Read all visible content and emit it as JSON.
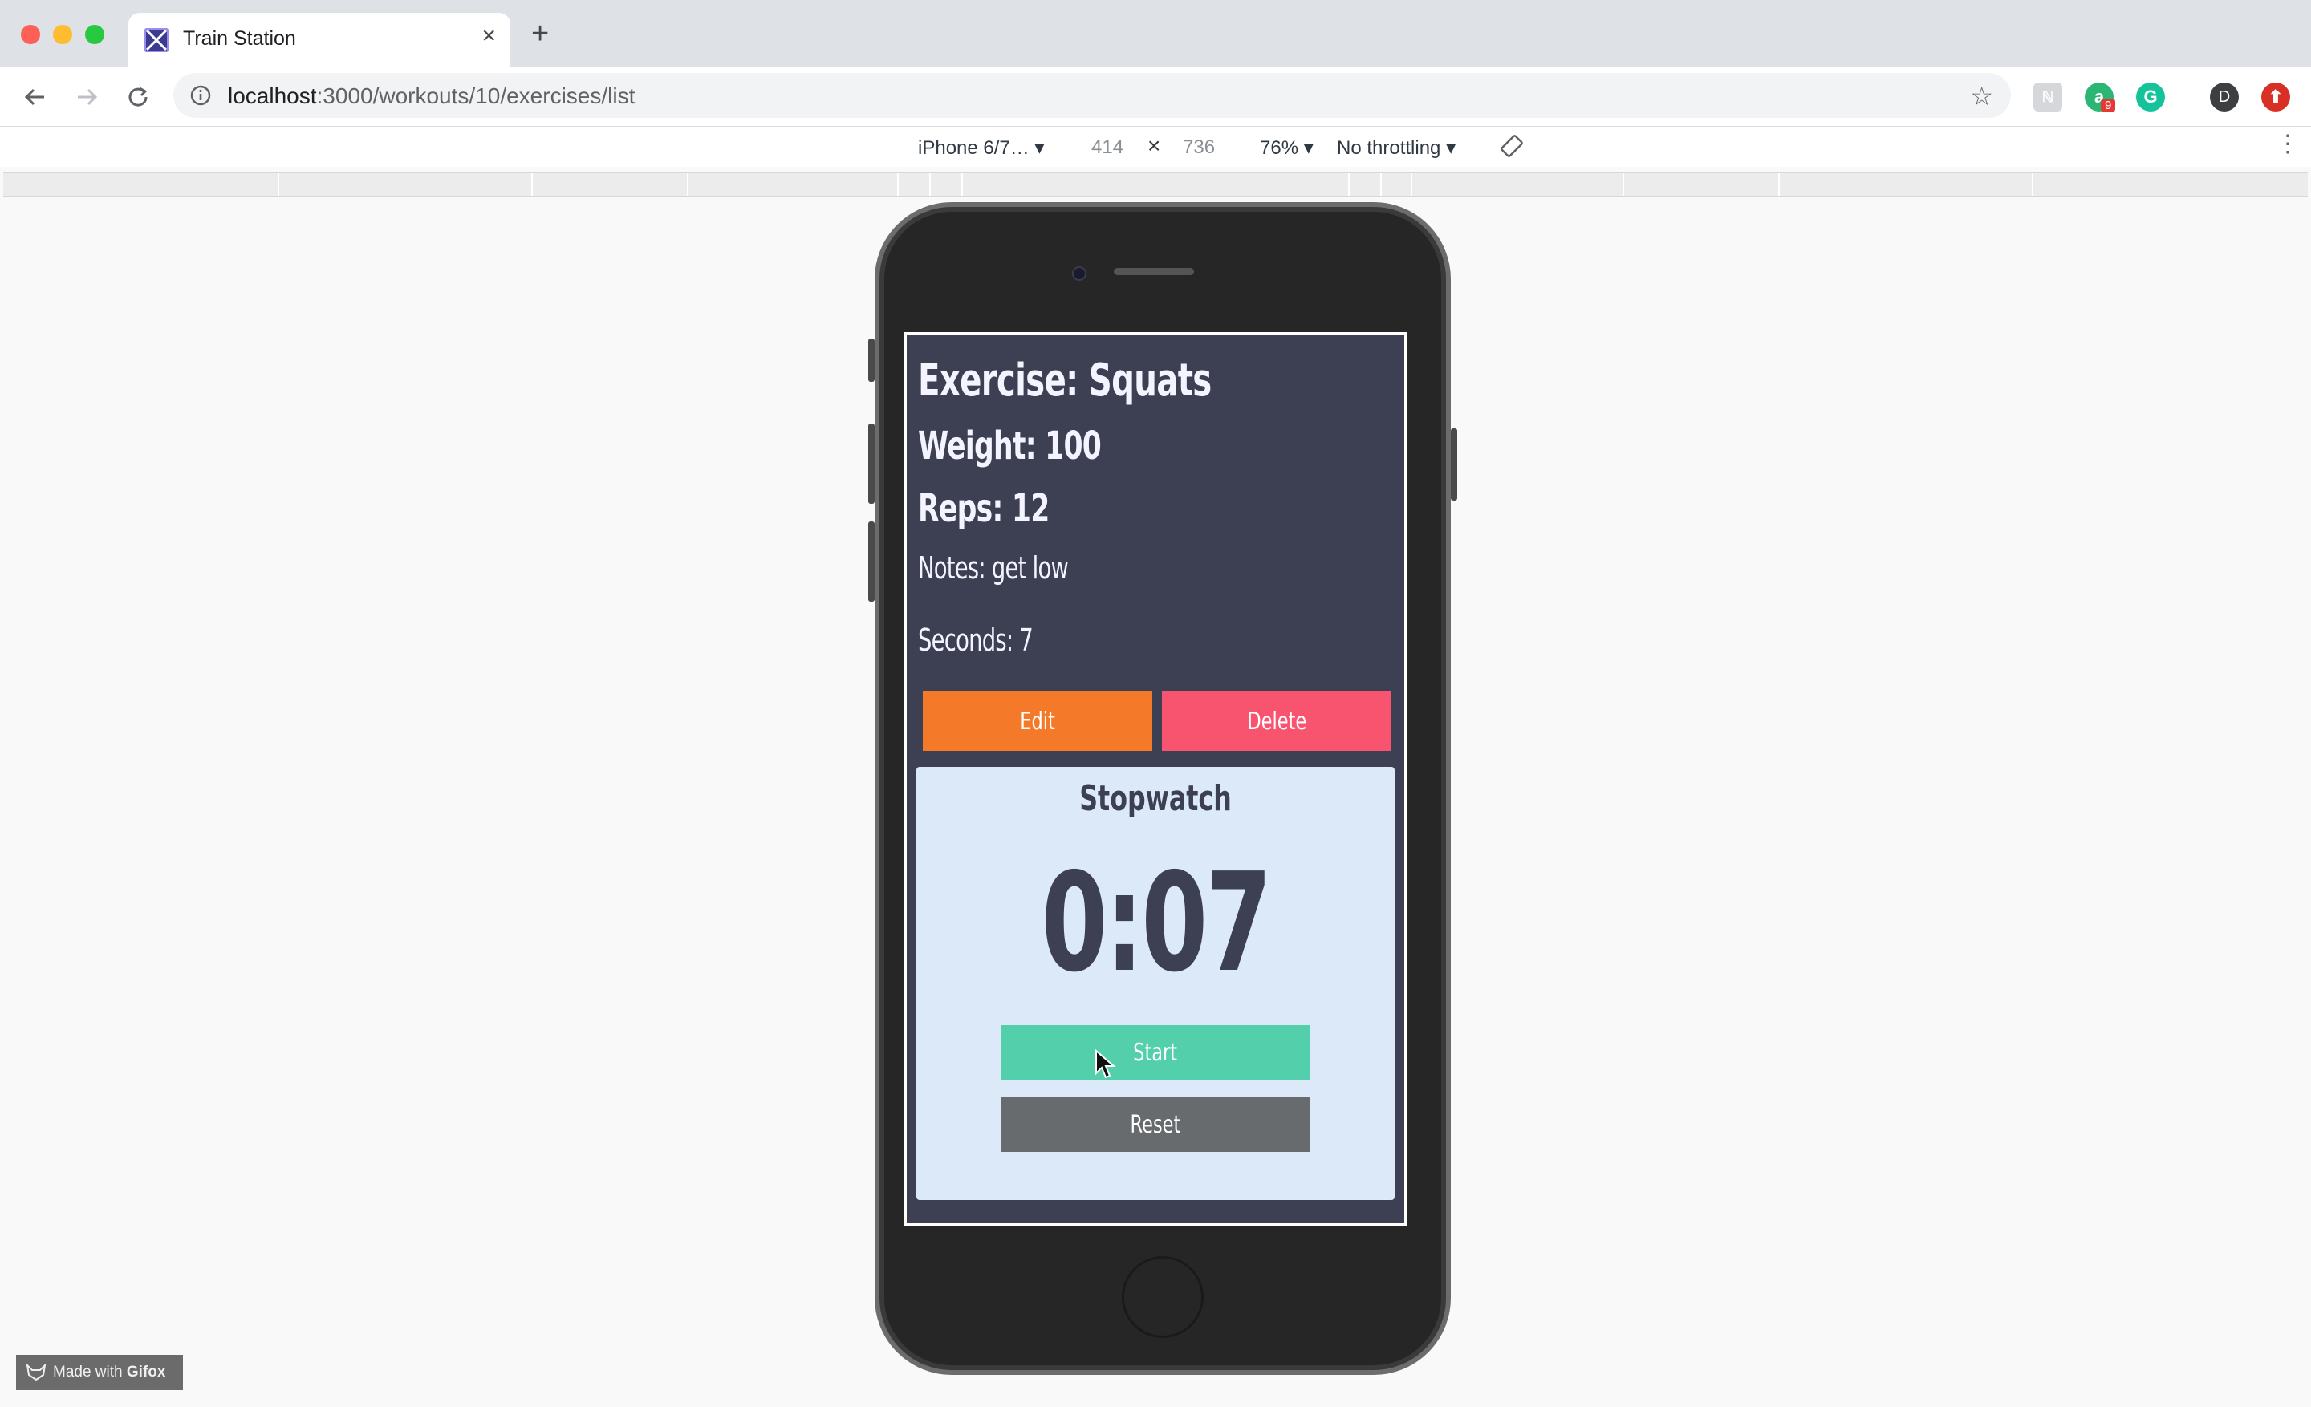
{
  "browser": {
    "tab_title": "Train Station",
    "url_host": "localhost",
    "url_path": ":3000/workouts/10/exercises/list",
    "profile_initial": "D",
    "extension_badge": "9"
  },
  "device_toolbar": {
    "device": "iPhone 6/7…",
    "width": "414",
    "times": "×",
    "height": "736",
    "zoom": "76%",
    "throttling": "No throttling"
  },
  "app": {
    "exercise": "Exercise: Squats",
    "weight": "Weight: 100",
    "reps": "Reps: 12",
    "notes": "Notes: get low",
    "seconds": "Seconds: 7",
    "edit_label": "Edit",
    "delete_label": "Delete",
    "stopwatch_title": "Stopwatch",
    "stopwatch_time": "0:07",
    "start_label": "Start",
    "reset_label": "Reset"
  },
  "colors": {
    "edit": "#f47a2a",
    "delete": "#f8536f",
    "start": "#53cfab",
    "reset": "#676b6e",
    "screen_bg": "#3d3f53",
    "panel_bg": "#dbe9f8"
  },
  "watermark": {
    "prefix": "Made with",
    "brand": "Gifox"
  }
}
